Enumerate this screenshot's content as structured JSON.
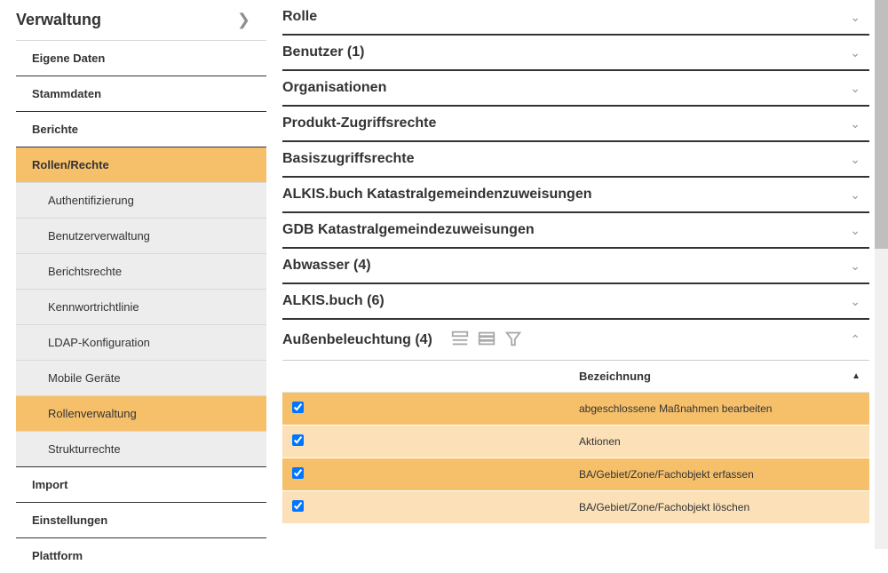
{
  "sidebar": {
    "title": "Verwaltung",
    "items": [
      {
        "label": "Eigene Daten",
        "level": 1,
        "active": false
      },
      {
        "label": "Stammdaten",
        "level": 1,
        "active": false
      },
      {
        "label": "Berichte",
        "level": 1,
        "active": false
      },
      {
        "label": "Rollen/Rechte",
        "level": 1,
        "active": true
      },
      {
        "label": "Authentifizierung",
        "level": 2,
        "active": false
      },
      {
        "label": "Benutzerverwaltung",
        "level": 2,
        "active": false
      },
      {
        "label": "Berichtsrechte",
        "level": 2,
        "active": false
      },
      {
        "label": "Kennwortrichtlinie",
        "level": 2,
        "active": false
      },
      {
        "label": "LDAP-Konfiguration",
        "level": 2,
        "active": false
      },
      {
        "label": "Mobile Geräte",
        "level": 2,
        "active": false
      },
      {
        "label": "Rollenverwaltung",
        "level": 2,
        "active": true
      },
      {
        "label": "Strukturrechte",
        "level": 2,
        "active": false
      },
      {
        "label": "Import",
        "level": 1,
        "active": false
      },
      {
        "label": "Einstellungen",
        "level": 1,
        "active": false
      },
      {
        "label": "Plattform",
        "level": 1,
        "active": false
      }
    ]
  },
  "accordion": {
    "sections": [
      {
        "title": "Rolle",
        "expanded": false
      },
      {
        "title": "Benutzer (1)",
        "expanded": false
      },
      {
        "title": "Organisationen",
        "expanded": false
      },
      {
        "title": "Produkt-Zugriffsrechte",
        "expanded": false
      },
      {
        "title": "Basiszugriffsrechte",
        "expanded": false
      },
      {
        "title": "ALKIS.buch Katastralgemeindenzuweisungen",
        "expanded": false
      },
      {
        "title": "GDB Katastralgemeindezuweisungen",
        "expanded": false
      },
      {
        "title": "Abwasser (4)",
        "expanded": false
      },
      {
        "title": "ALKIS.buch (6)",
        "expanded": false
      },
      {
        "title": "Außenbeleuchtung (4)",
        "expanded": true
      }
    ]
  },
  "table": {
    "column_header": "Bezeichnung",
    "rows": [
      {
        "checked": true,
        "label": "abgeschlossene Maßnahmen bearbeiten"
      },
      {
        "checked": true,
        "label": "Aktionen"
      },
      {
        "checked": true,
        "label": "BA/Gebiet/Zone/Fachobjekt erfassen"
      },
      {
        "checked": true,
        "label": "BA/Gebiet/Zone/Fachobjekt löschen"
      }
    ]
  }
}
